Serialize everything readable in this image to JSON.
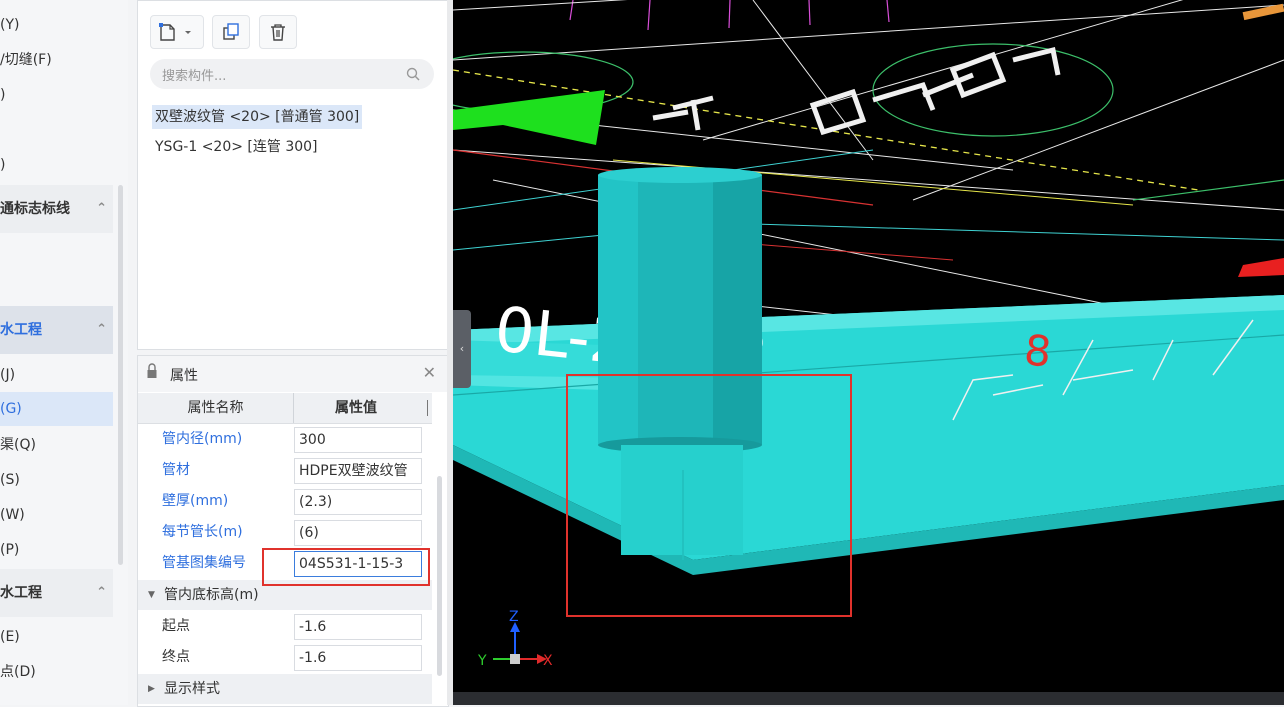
{
  "nav": {
    "items": [
      {
        "label": "(Y)"
      },
      {
        "label": "/切缝(F)"
      },
      {
        "label": ")"
      },
      {
        "label": ")"
      },
      {
        "label": "通标志标线"
      },
      {
        "label": "水工程"
      },
      {
        "label": "(J)"
      },
      {
        "label": "(G)"
      },
      {
        "label": "渠(Q)"
      },
      {
        "label": "(S)"
      },
      {
        "label": "(W)"
      },
      {
        "label": "(P)"
      },
      {
        "label": "水工程"
      },
      {
        "label": "(E)"
      },
      {
        "label": "点(D)"
      }
    ]
  },
  "components": {
    "search_placeholder": "搜索构件...",
    "items": [
      {
        "label": "双壁波纹管 <20> [普通管 300]"
      },
      {
        "label": "YSG-1 <20> [连管 300]"
      }
    ]
  },
  "properties": {
    "title": "属性",
    "col_name": "属性名称",
    "col_value": "属性值",
    "rows": [
      {
        "label": "管内径(mm)",
        "value": "300"
      },
      {
        "label": "管材",
        "value": "HDPE双壁波纹管"
      },
      {
        "label": "壁厚(mm)",
        "value": "(2.3)"
      },
      {
        "label": "每节管长(m)",
        "value": "(6)"
      },
      {
        "label": "管基图集编号",
        "value": "04S531-1-15-3"
      }
    ],
    "group_bottom_elev": "管内底标高(m)",
    "start_label": "起点",
    "start_value": "-1.6",
    "end_label": "终点",
    "end_value": "-1.6",
    "group_display": "显示样式"
  },
  "viewport": {
    "axis_x": "X",
    "axis_y": "Y",
    "axis_z": "Z",
    "scene_text_1": "0L-2.028",
    "scene_text_2": "8"
  },
  "colors": {
    "accent": "#2f6fde",
    "pipe_cyan": "#29d6d3",
    "highlight_red": "#e0322c",
    "marker_green": "#1ee01e"
  }
}
